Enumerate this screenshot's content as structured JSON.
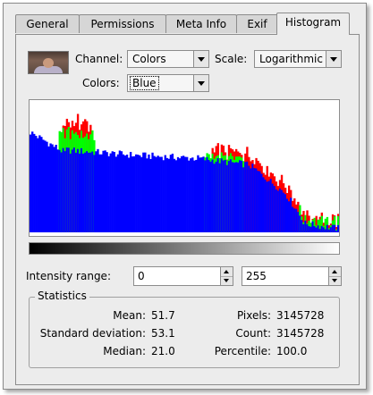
{
  "tabs": [
    {
      "label": "General",
      "active": false
    },
    {
      "label": "Permissions",
      "active": false
    },
    {
      "label": "Meta Info",
      "active": false
    },
    {
      "label": "Exif",
      "active": false
    },
    {
      "label": "Histogram",
      "active": true
    }
  ],
  "controls": {
    "channel_label": "Channel:",
    "channel_value": "Colors",
    "scale_label": "Scale:",
    "scale_value": "Logarithmic",
    "colors_label": "Colors:",
    "colors_value": "Blue"
  },
  "intensity": {
    "label": "Intensity range:",
    "min": "0",
    "max": "255"
  },
  "statistics": {
    "title": "Statistics",
    "mean_label": "Mean:",
    "mean_value": "51.7",
    "std_label": "Standard deviation:",
    "std_value": "53.1",
    "median_label": "Median:",
    "median_value": "21.0",
    "pixels_label": "Pixels:",
    "pixels_value": "3145728",
    "count_label": "Count:",
    "count_value": "3145728",
    "percentile_label": "Percentile:",
    "percentile_value": "100.0"
  },
  "colors": {
    "blue": "#0000ff",
    "green": "#00ff00",
    "red": "#ff0000"
  }
}
